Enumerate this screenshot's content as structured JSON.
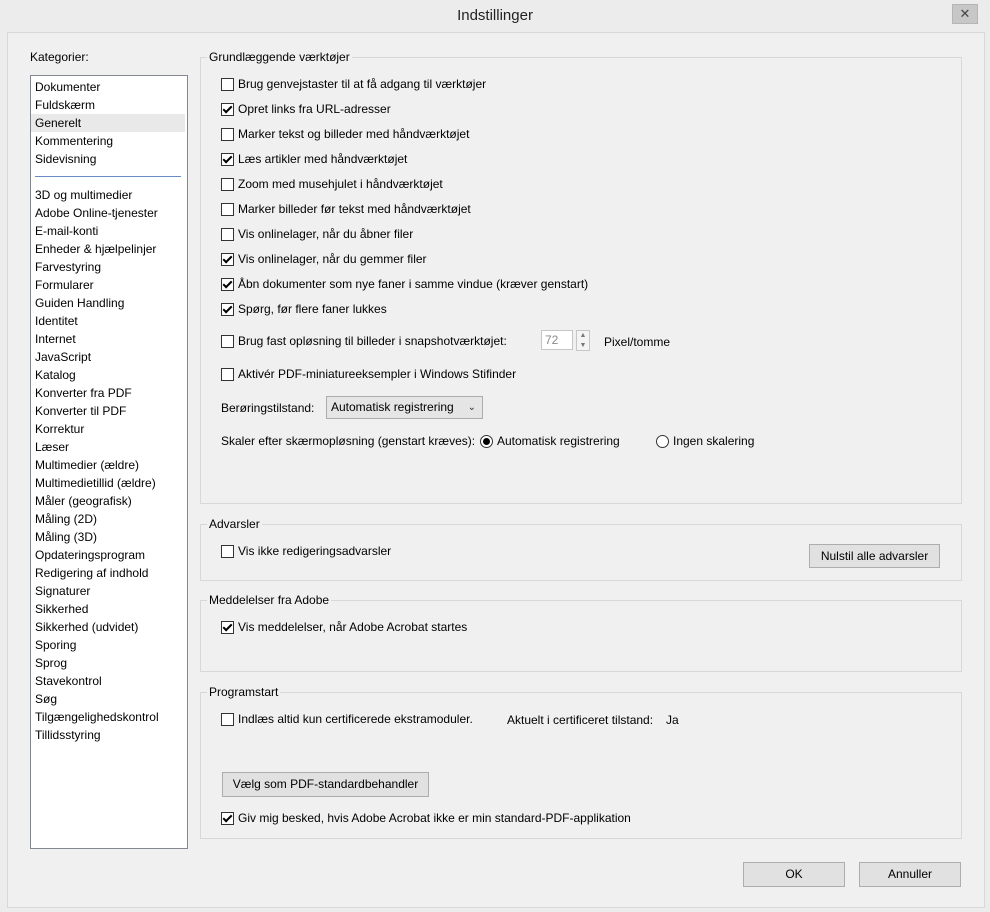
{
  "window": {
    "title": "Indstillinger",
    "close_glyph": "✕"
  },
  "categories": {
    "label": "Kategorier:",
    "top_items": [
      "Dokumenter",
      "Fuldskærm",
      "Generelt",
      "Kommentering",
      "Sidevisning"
    ],
    "selected": "Generelt",
    "items": [
      "3D og multimedier",
      "Adobe Online-tjenester",
      "E-mail-konti",
      "Enheder & hjælpelinjer",
      "Farvestyring",
      "Formularer",
      "Guiden Handling",
      "Identitet",
      "Internet",
      "JavaScript",
      "Katalog",
      "Konverter fra PDF",
      "Konverter til PDF",
      "Korrektur",
      "Læser",
      "Multimedier (ældre)",
      "Multimedietillid (ældre)",
      "Måler (geografisk)",
      "Måling (2D)",
      "Måling (3D)",
      "Opdateringsprogram",
      "Redigering af indhold",
      "Signaturer",
      "Sikkerhed",
      "Sikkerhed (udvidet)",
      "Sporing",
      "Sprog",
      "Stavekontrol",
      "Søg",
      "Tilgængelighedskontrol",
      "Tillidsstyring"
    ]
  },
  "basic": {
    "title": "Grundlæggende værktøjer",
    "options": [
      {
        "label": "Brug genvejstaster til at få adgang til værktøjer",
        "checked": false
      },
      {
        "label": "Opret links fra URL-adresser",
        "checked": true
      },
      {
        "label": "Marker tekst og billeder med håndværktøjet",
        "checked": false
      },
      {
        "label": "Læs artikler med håndværktøjet",
        "checked": true
      },
      {
        "label": "Zoom med musehjulet i håndværktøjet",
        "checked": false
      },
      {
        "label": "Marker billeder før tekst med håndværktøjet",
        "checked": false
      },
      {
        "label": "Vis onlinelager, når du åbner filer",
        "checked": false
      },
      {
        "label": "Vis onlinelager, når du gemmer filer",
        "checked": true
      },
      {
        "label": "Åbn dokumenter som nye faner i samme vindue (kræver genstart)",
        "checked": true
      },
      {
        "label": "Spørg, før flere faner lukkes",
        "checked": true
      }
    ],
    "snapshot": {
      "label": "Brug fast opløsning til billeder i snapshotværktøjet:",
      "checked": false,
      "value": "72",
      "unit": "Pixel/tomme"
    },
    "thumbnails": {
      "label": "Aktivér PDF-miniatureeksempler i Windows Stifinder",
      "checked": false
    },
    "touch": {
      "label": "Berøringstilstand:",
      "value": "Automatisk registrering"
    },
    "scale": {
      "label": "Skaler efter skærmopløsning (genstart kræves):",
      "opt_auto": "Automatisk registrering",
      "opt_none": "Ingen skalering",
      "selected": "auto"
    }
  },
  "warnings": {
    "title": "Advarsler",
    "option": {
      "label": "Vis ikke redigeringsadvarsler",
      "checked": false
    },
    "reset_button": "Nulstil alle advarsler"
  },
  "messages": {
    "title": "Meddelelser fra Adobe",
    "option": {
      "label": "Vis meddelelser, når Adobe Acrobat startes",
      "checked": true
    }
  },
  "startup": {
    "title": "Programstart",
    "certified": {
      "label": "Indlæs altid kun certificerede ekstramoduler.",
      "checked": false
    },
    "state_label": "Aktuelt i certificeret tilstand:",
    "state_value": "Ja",
    "default_button": "Vælg som PDF-standardbehandler",
    "notify": {
      "label": "Giv mig besked, hvis Adobe Acrobat ikke er min standard-PDF-applikation",
      "checked": true
    }
  },
  "footer": {
    "ok": "OK",
    "cancel": "Annuller"
  }
}
